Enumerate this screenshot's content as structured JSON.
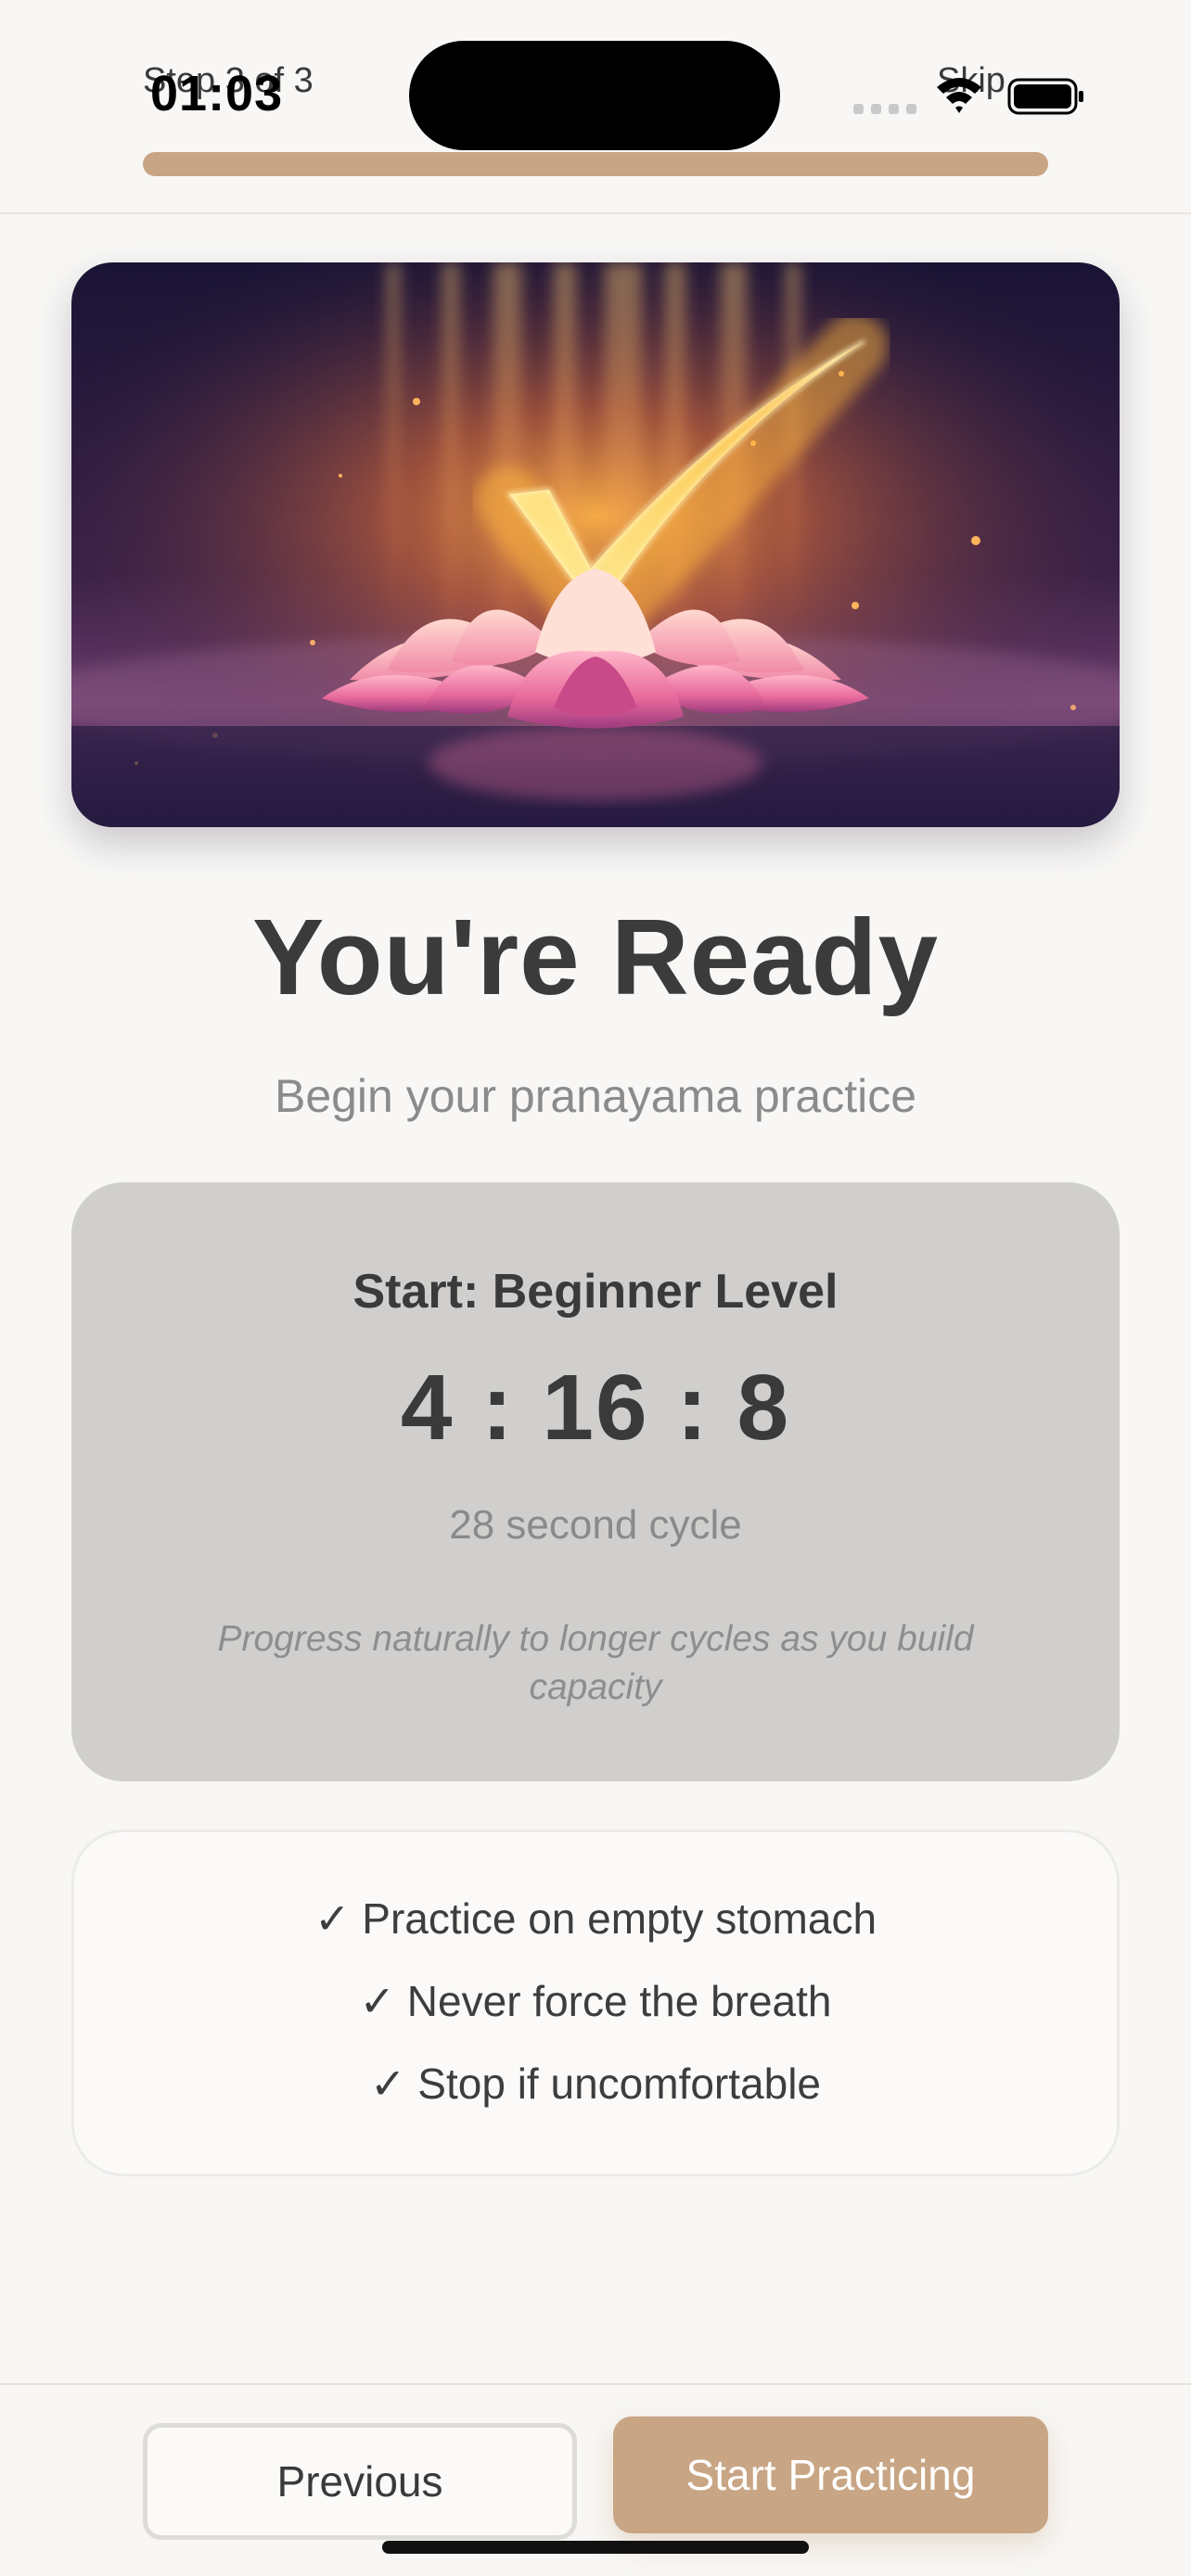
{
  "status_bar": {
    "time": "01:03",
    "signal_icon": "cellular-signal-icon",
    "wifi_icon": "wifi-icon",
    "battery_icon": "battery-icon"
  },
  "header": {
    "step_label": "Step 3 of 3",
    "skip_label": "Skip",
    "progress_fraction": 1.0,
    "accent_color": "#c8a584"
  },
  "hero": {
    "image_icon": "glowing-checkmark-over-lotus-image"
  },
  "main": {
    "title": "You're Ready",
    "subtitle": "Begin your pranayama practice"
  },
  "level_card": {
    "heading": "Start: Beginner Level",
    "ratio": "4 : 16 : 8",
    "cycle": "28 second cycle",
    "note": "Progress naturally to longer cycles as you build capacity"
  },
  "tips": [
    {
      "text": "✓ Practice on empty stomach"
    },
    {
      "text": "✓ Never force the breath"
    },
    {
      "text": "✓ Stop if uncomfortable"
    }
  ],
  "footer": {
    "previous_label": "Previous",
    "start_label": "Start Practicing"
  }
}
